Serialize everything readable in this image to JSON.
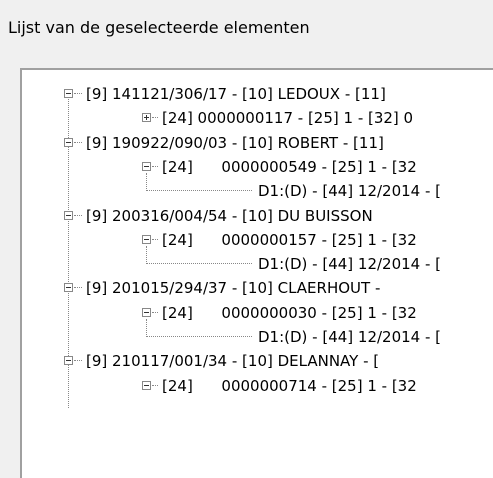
{
  "dialog": {
    "title": "Lijst van de geselecteerde elementen"
  },
  "tree": {
    "rows": [
      {
        "text": "[9] 141121/306/17 - [10] LEDOUX - [11]",
        "expander": "minus",
        "level": 0
      },
      {
        "text": "[24] 0000000117 - [25] 1 - [32] 0",
        "expander": "plus",
        "level": 1
      },
      {
        "text": "[9] 190922/090/03 - [10] ROBERT - [11]",
        "expander": "minus",
        "level": 0
      },
      {
        "text": "[24]      0000000549 - [25] 1 - [32",
        "expander": "minus",
        "level": 1
      },
      {
        "text": "D1:(D) - [44] 12/2014 - [",
        "expander": "none",
        "level": 2
      },
      {
        "text": "[9] 200316/004/54 - [10] DU BUISSON",
        "expander": "minus",
        "level": 0
      },
      {
        "text": "[24]      0000000157 - [25] 1 - [32",
        "expander": "minus",
        "level": 1
      },
      {
        "text": "D1:(D) - [44] 12/2014 - [",
        "expander": "none",
        "level": 2
      },
      {
        "text": "[9] 201015/294/37 - [10] CLAERHOUT -",
        "expander": "minus",
        "level": 0
      },
      {
        "text": "[24]      0000000030 - [25] 1 - [32",
        "expander": "minus",
        "level": 1
      },
      {
        "text": "D1:(D) - [44] 12/2014 - [",
        "expander": "none",
        "level": 2
      },
      {
        "text": "[9] 210117/001/34 - [10] DELANNAY - [",
        "expander": "minus",
        "level": 0
      },
      {
        "text": "[24]      0000000714 - [25] 1 - [32",
        "expander": "minus",
        "level": 1
      }
    ]
  }
}
